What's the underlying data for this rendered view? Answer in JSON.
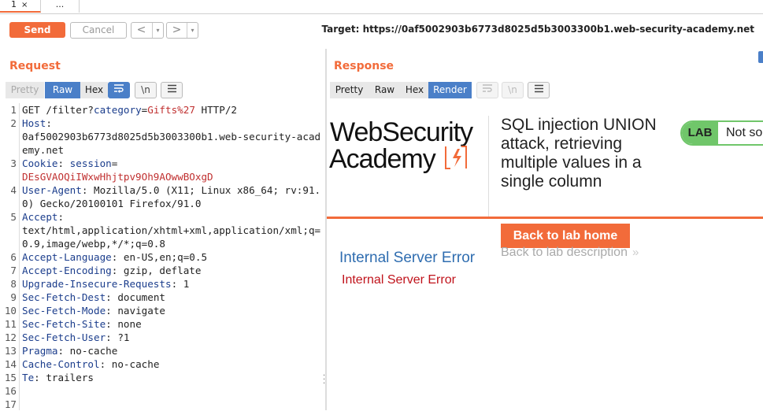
{
  "tabs": [
    {
      "label": "1",
      "close": "×"
    },
    {
      "label": "..."
    }
  ],
  "toolbar": {
    "send_label": "Send",
    "cancel_label": "Cancel",
    "back_arrow": "<",
    "forward_arrow": ">",
    "dropdown": "▾",
    "target": "Target: https://0af5002903b6773d8025d5b3003300b1.web-security-academy.net"
  },
  "request": {
    "title": "Request",
    "view_tabs": [
      "Pretty",
      "Raw",
      "Hex"
    ],
    "active_view": "Raw",
    "icons": {
      "wrap": "wrap-icon",
      "newline": "\\n",
      "menu": "menu-icon"
    },
    "newline_label": "\\n",
    "lines": [
      {
        "n": "1",
        "parts": [
          [
            "",
            "GET /filter?"
          ],
          [
            "k",
            "category"
          ],
          [
            "",
            "="
          ],
          [
            "red",
            "Gifts%27"
          ],
          [
            "",
            " HTTP/2"
          ]
        ]
      },
      {
        "n": "2",
        "parts": [
          [
            "k",
            "Host"
          ],
          [
            "",
            ":\n0af5002903b6773d8025d5b3003300b1.web-security-academy.net"
          ]
        ]
      },
      {
        "n": "3",
        "parts": [
          [
            "k",
            "Cookie"
          ],
          [
            "",
            ": "
          ],
          [
            "k",
            "session"
          ],
          [
            "",
            "=\n"
          ],
          [
            "red",
            "DEsGVAOQiIWxwHhjtpv9Oh9AOwwBOxgD"
          ]
        ]
      },
      {
        "n": "4",
        "parts": [
          [
            "k",
            "User-Agent"
          ],
          [
            "",
            ": Mozilla/5.0 (X11; Linux x86_64; rv:91.0) Gecko/20100101 Firefox/91.0"
          ]
        ]
      },
      {
        "n": "5",
        "parts": [
          [
            "k",
            "Accept"
          ],
          [
            "",
            ":\ntext/html,application/xhtml+xml,application/xml;q=0.9,image/webp,*/*;q=0.8"
          ]
        ]
      },
      {
        "n": "6",
        "parts": [
          [
            "k",
            "Accept-Language"
          ],
          [
            "",
            ": en-US,en;q=0.5"
          ]
        ]
      },
      {
        "n": "7",
        "parts": [
          [
            "k",
            "Accept-Encoding"
          ],
          [
            "",
            ": gzip, deflate"
          ]
        ]
      },
      {
        "n": "8",
        "parts": [
          [
            "k",
            "Upgrade-Insecure-Requests"
          ],
          [
            "",
            ": 1"
          ]
        ]
      },
      {
        "n": "9",
        "parts": [
          [
            "k",
            "Sec-Fetch-Dest"
          ],
          [
            "",
            ": document"
          ]
        ]
      },
      {
        "n": "10",
        "parts": [
          [
            "k",
            "Sec-Fetch-Mode"
          ],
          [
            "",
            ": navigate"
          ]
        ]
      },
      {
        "n": "11",
        "parts": [
          [
            "k",
            "Sec-Fetch-Site"
          ],
          [
            "",
            ": none"
          ]
        ]
      },
      {
        "n": "12",
        "parts": [
          [
            "k",
            "Sec-Fetch-User"
          ],
          [
            "",
            ": ?1"
          ]
        ]
      },
      {
        "n": "13",
        "parts": [
          [
            "k",
            "Pragma"
          ],
          [
            "",
            ": no-cache"
          ]
        ]
      },
      {
        "n": "14",
        "parts": [
          [
            "k",
            "Cache-Control"
          ],
          [
            "",
            ": no-cache"
          ]
        ]
      },
      {
        "n": "15",
        "parts": [
          [
            "k",
            "Te"
          ],
          [
            "",
            ": trailers"
          ]
        ]
      },
      {
        "n": "16",
        "parts": []
      },
      {
        "n": "17",
        "parts": []
      }
    ]
  },
  "response": {
    "title": "Response",
    "view_tabs": [
      "Pretty",
      "Raw",
      "Hex",
      "Render"
    ],
    "active_view": "Render",
    "newline_label": "\\n",
    "render": {
      "logo_line1": "WebSecurity",
      "logo_line2": "Academy",
      "lab_title": "SQL injection UNION attack, retrieving multiple values in a single column",
      "badge_label": "LAB",
      "badge_status": "Not solved",
      "back_home": "Back to lab home",
      "back_desc": "Back to lab description",
      "back_desc_chevron": "»",
      "error_heading": "Internal Server Error",
      "error_text": "Internal Server Error"
    }
  },
  "colors": {
    "accent": "#f26b3a",
    "active": "#4a7fc8",
    "badge": "#70c66a",
    "link": "#2f6db0",
    "error": "#c0131b"
  }
}
